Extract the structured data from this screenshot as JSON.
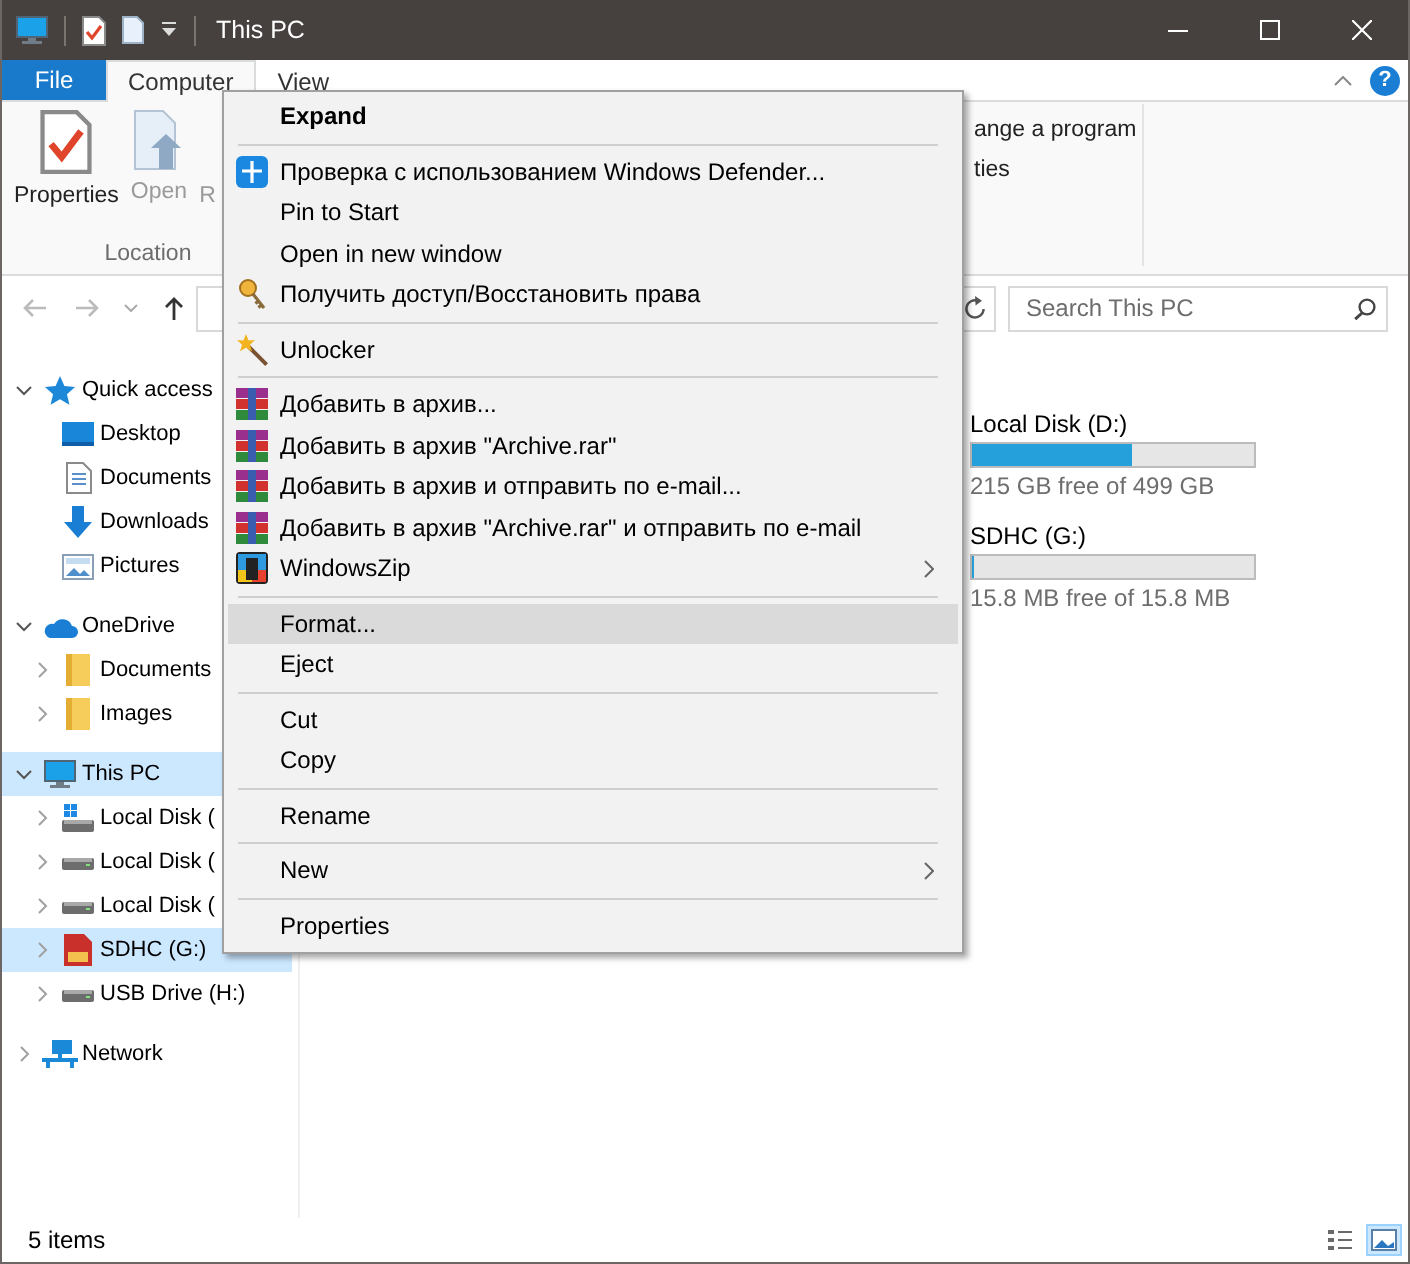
{
  "window": {
    "title": "This PC"
  },
  "ribbon": {
    "tabs": [
      {
        "label": "File",
        "kind": "file",
        "selected": false
      },
      {
        "label": "Computer",
        "kind": "tab",
        "selected": true
      },
      {
        "label": "View",
        "kind": "tab",
        "selected": false
      }
    ],
    "help": "?",
    "location_group": {
      "label": "Location",
      "buttons": [
        {
          "label": "Properties",
          "kind": "properties",
          "disabled": false
        },
        {
          "label": "Open",
          "kind": "open",
          "disabled": true
        },
        {
          "label": "R",
          "kind": "partial",
          "disabled": true
        }
      ]
    },
    "partial_group": {
      "commands": [
        "ange a program",
        "ties"
      ]
    }
  },
  "address_bar": {
    "search": {
      "placeholder": "Search This PC"
    }
  },
  "navigation": {
    "items": [
      {
        "label": "Quick access",
        "kind": "pinned",
        "expanded": true,
        "selected": false,
        "children": [
          {
            "label": "Desktop",
            "kind": "desktop",
            "selected": false
          },
          {
            "label": "Documents",
            "kind": "documents",
            "selected": false
          },
          {
            "label": "Downloads",
            "kind": "downloads",
            "selected": false
          },
          {
            "label": "Pictures",
            "kind": "pictures",
            "selected": false
          }
        ]
      },
      {
        "label": "OneDrive",
        "kind": "cloud",
        "expanded": true,
        "selected": false,
        "children": [
          {
            "label": "Documents",
            "kind": "folder",
            "expanded": false,
            "selected": false
          },
          {
            "label": "Images",
            "kind": "folder",
            "expanded": false,
            "selected": false
          }
        ]
      },
      {
        "label": "This PC",
        "kind": "computer",
        "expanded": true,
        "selected": true,
        "children": [
          {
            "label": "Local Disk (",
            "kind": "systemdrive",
            "expanded": false,
            "selected": false
          },
          {
            "label": "Local Disk (",
            "kind": "drive",
            "expanded": false,
            "selected": false
          },
          {
            "label": "Local Disk (",
            "kind": "drive",
            "expanded": false,
            "selected": false
          },
          {
            "label": "SDHC (G:)",
            "kind": "sdcard",
            "expanded": false,
            "selected": true
          },
          {
            "label": "USB Drive (H:)",
            "kind": "drive",
            "expanded": false,
            "selected": false
          }
        ]
      },
      {
        "label": "Network",
        "kind": "network",
        "expanded": false,
        "selected": false
      }
    ]
  },
  "drives": [
    {
      "name": "Local Disk (D:)",
      "level": 0.57,
      "free_space": "215 GB free of 499 GB"
    },
    {
      "name": "SDHC (G:)",
      "level": 0,
      "free_space": "15.8 MB free of 15.8 MB"
    }
  ],
  "context_menu": {
    "groups": [
      {
        "items": [
          {
            "label": "Expand",
            "kind": "default",
            "selected": false
          }
        ]
      },
      {
        "items": [
          {
            "label": "Проверка с использованием Windows Defender...",
            "kind": "defender",
            "selected": false
          },
          {
            "label": "Pin to Start",
            "kind": "plain",
            "selected": false
          },
          {
            "label": "Open in new window",
            "kind": "plain",
            "selected": false
          },
          {
            "label": "Получить доступ/Восстановить права",
            "kind": "access",
            "selected": false
          }
        ]
      },
      {
        "items": [
          {
            "label": "Unlocker",
            "kind": "unlocker",
            "selected": false
          }
        ]
      },
      {
        "items": [
          {
            "label": "Добавить в архив...",
            "kind": "archive",
            "selected": false
          },
          {
            "label": "Добавить в архив \"Archive.rar\"",
            "kind": "archive",
            "selected": false
          },
          {
            "label": "Добавить в архив и отправить по e-mail...",
            "kind": "archive",
            "selected": false
          },
          {
            "label": "Добавить в архив \"Archive.rar\" и отправить по e-mail",
            "kind": "archive",
            "selected": false
          },
          {
            "label": "WindowsZip",
            "kind": "windowszip",
            "selected": false
          }
        ]
      },
      {
        "items": [
          {
            "label": "Format...",
            "kind": "plain",
            "selected": true
          },
          {
            "label": "Eject",
            "kind": "plain",
            "selected": false
          }
        ]
      },
      {
        "items": [
          {
            "label": "Cut",
            "kind": "plain",
            "selected": false
          },
          {
            "label": "Copy",
            "kind": "plain",
            "selected": false
          }
        ]
      },
      {
        "items": [
          {
            "label": "Rename",
            "kind": "plain",
            "selected": false
          }
        ]
      },
      {
        "items": [
          {
            "label": "New",
            "kind": "submenu",
            "selected": false
          }
        ]
      },
      {
        "items": [
          {
            "label": "Properties",
            "kind": "plain",
            "selected": false
          }
        ]
      }
    ]
  },
  "status_bar": {
    "item_count": "5 items",
    "views": [
      {
        "kind": "details",
        "selected": false
      },
      {
        "kind": "thumbnails",
        "selected": true
      }
    ]
  }
}
